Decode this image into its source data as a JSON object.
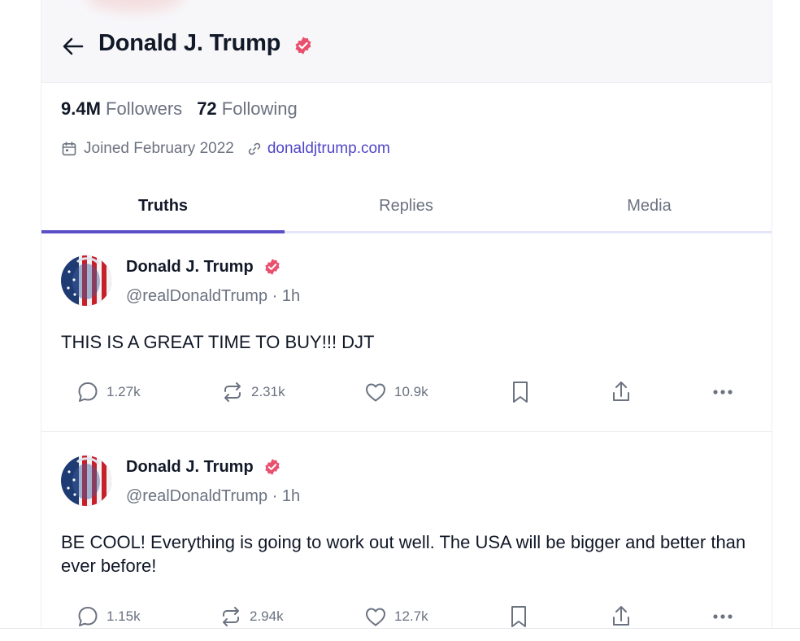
{
  "header": {
    "title": "Donald J. Trump"
  },
  "profile": {
    "followers_count": "9.4M",
    "followers_label": "Followers",
    "following_count": "72",
    "following_label": "Following",
    "joined": "Joined February 2022",
    "website": "donaldjtrump.com"
  },
  "tabs": [
    {
      "label": "Truths",
      "active": true
    },
    {
      "label": "Replies",
      "active": false
    },
    {
      "label": "Media",
      "active": false
    }
  ],
  "posts": [
    {
      "author": "Donald J. Trump",
      "handle": "@realDonaldTrump",
      "time": "1h",
      "text": "THIS IS A GREAT TIME TO BUY!!! DJT",
      "replies": "1.27k",
      "reposts": "2.31k",
      "likes": "10.9k"
    },
    {
      "author": "Donald J. Trump",
      "handle": "@realDonaldTrump",
      "time": "1h",
      "text": "BE COOL! Everything is going to work out well. The USA will be bigger and better than ever before!",
      "replies": "1.15k",
      "reposts": "2.94k",
      "likes": "12.7k"
    }
  ],
  "icons": {
    "back": "arrow-left-icon",
    "verified": "verified-badge-icon",
    "calendar": "calendar-icon",
    "link": "link-icon",
    "reply": "comment-icon",
    "repost": "repost-icon",
    "like": "heart-icon",
    "bookmark": "bookmark-icon",
    "share": "share-icon",
    "more": "more-icon"
  },
  "colors": {
    "accent": "#5b50c8",
    "link": "#4f46c8",
    "verified": "#e8506e",
    "muted_text": "#6b7280"
  }
}
